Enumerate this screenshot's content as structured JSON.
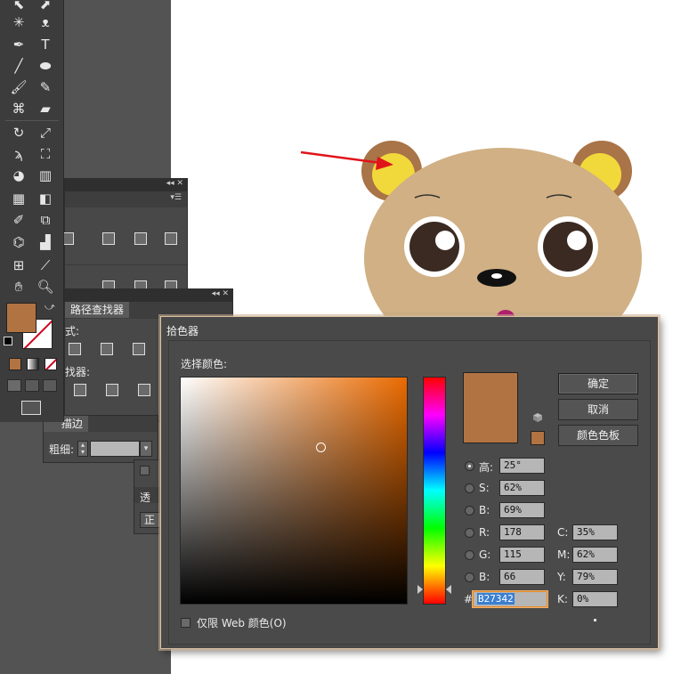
{
  "panels": {
    "pathfinder_tab": "路径查找器",
    "shape_modes_label": "式:",
    "pathfinders_label": "找器:",
    "stroke_tab": "描边",
    "weight_label": "粗细:",
    "transparency_tab": "透",
    "blend_mode_value": "正"
  },
  "picker": {
    "title": "拾色器",
    "select_label": "选择颜色:",
    "color_hex_value": "#b27342",
    "buttons": {
      "ok": "确定",
      "cancel": "取消",
      "swatches": "颜色色板"
    },
    "hsb": [
      {
        "label": "高:",
        "value": "25°",
        "selected": true
      },
      {
        "label": "S:",
        "value": "62%",
        "selected": false
      },
      {
        "label": "B:",
        "value": "69%",
        "selected": false
      }
    ],
    "rgb": [
      {
        "label": "R:",
        "value": "178"
      },
      {
        "label": "G:",
        "value": "115"
      },
      {
        "label": "B:",
        "value": "66"
      }
    ],
    "cmyk": [
      {
        "label": "C:",
        "value": "35%"
      },
      {
        "label": "M:",
        "value": "62%"
      },
      {
        "label": "Y:",
        "value": "79%"
      },
      {
        "label": "K:",
        "value": "0%"
      }
    ],
    "hex_label": "#",
    "hex_value": "B27342",
    "web_only_label": "仅限 Web 颜色(O)"
  },
  "colors": {
    "fill": "#b27342",
    "stroke": "#ffffff",
    "bear_face": "#d0b084",
    "bear_ear_outer": "#a97447",
    "bear_ear_inner": "#f2d93b",
    "arrow": "#e0141a",
    "hue_max": "#ea6a00"
  },
  "icons": [
    "selection-tool-icon",
    "direct-selection-tool-icon",
    "magic-wand-icon",
    "lasso-icon",
    "pen-icon",
    "type-icon",
    "line-icon",
    "ellipse-icon",
    "paintbrush-icon",
    "pencil-icon",
    "blob-brush-icon",
    "eraser-icon",
    "rotate-icon",
    "scale-icon",
    "warp-icon",
    "free-transform-icon",
    "shape-builder-icon",
    "graph-icon",
    "mesh-icon",
    "gradient-icon",
    "eyedropper-icon",
    "blend-icon",
    "symbol-sprayer-icon",
    "column-graph-icon",
    "artboard-icon",
    "slice-icon",
    "hand-icon",
    "zoom-icon"
  ]
}
